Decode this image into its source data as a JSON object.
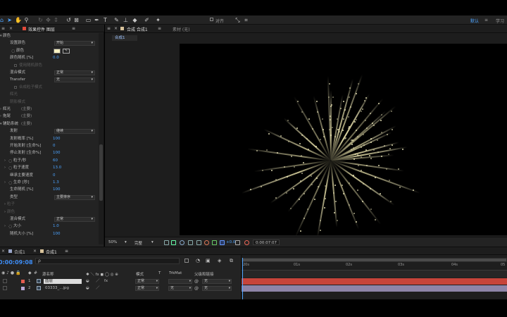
{
  "toolbar": {
    "snap_label": "对齐",
    "workspace_default": "默认",
    "workspace_learn": "学习"
  },
  "effects_panel": {
    "tab_title": "效果控件 图层",
    "rows": [
      {
        "label": "颜色",
        "value": ""
      },
      {
        "label": "设置颜色",
        "value": "开始"
      },
      {
        "label": "颜色",
        "value": ""
      },
      {
        "label": "颜色随机 [%]",
        "value": "0.0"
      },
      {
        "label": "使用随机颜色",
        "value": ""
      },
      {
        "label": "混合模式",
        "value": "正常"
      },
      {
        "label": "Transfer",
        "value": "无"
      },
      {
        "label": "合成粒子模式",
        "value": ""
      },
      {
        "label": "辉光",
        "value": ""
      },
      {
        "label": "阴影模式",
        "value": ""
      },
      {
        "label": "辉光",
        "value": "(主要)"
      },
      {
        "label": "拖尾",
        "value": "(主要)"
      },
      {
        "label": "辅助系统",
        "value": "(主要)"
      },
      {
        "label": "发射",
        "value": "继续"
      },
      {
        "label": "发射概率 [%]",
        "value": "100"
      },
      {
        "label": "开始发射 [生命%]",
        "value": "0"
      },
      {
        "label": "停止发射 [生命%]",
        "value": "100"
      },
      {
        "label": "粒子/秒",
        "value": "60"
      },
      {
        "label": "粒子速度",
        "value": "13.0"
      },
      {
        "label": "继承主要速度",
        "value": "0"
      },
      {
        "label": "生命 [秒]",
        "value": "1.3"
      },
      {
        "label": "生命随机 [%]",
        "value": "100"
      },
      {
        "label": "类型",
        "value": "主要排序"
      },
      {
        "label": "粒子",
        "value": ""
      },
      {
        "label": "颜色",
        "value": ""
      },
      {
        "label": "混合模式",
        "value": "正常"
      },
      {
        "label": "大小",
        "value": "1.0"
      },
      {
        "label": "随机大小 [%]",
        "value": "100"
      }
    ]
  },
  "comp_panel": {
    "tab_title": "合成 合成1",
    "footage_tab": "素材 (无)",
    "sub_tab": "合成1",
    "zoom": "50%",
    "quality": "完整",
    "exposure": "+0.0",
    "timecode": "0:00:07:07"
  },
  "timeline": {
    "tab_render_queue": "合成1",
    "tab_comp": "合成1",
    "current_time": "0:00:09:08",
    "search_placeholder": "ρ",
    "headers": {
      "source_name": "源名称",
      "mode": "模式",
      "trkmat": "TrkMat",
      "parent": "父级和链接"
    },
    "layers": [
      {
        "num": "1",
        "name": "图层",
        "mode": "正常",
        "trkmat": "",
        "parent": "无",
        "color": "#e35b4f"
      },
      {
        "num": "2",
        "name": "03333_...jpg",
        "mode": "正常",
        "trkmat": "无",
        "parent": "无",
        "color": "#b7a6d6"
      }
    ],
    "ruler": [
      "20s",
      "01s",
      "02s",
      "03s",
      "04s",
      "05"
    ]
  },
  "colors": {
    "accent": "#4ba3ff",
    "time_blue": "#3e8ef7",
    "layer1_bar": "#c7443a",
    "layer2_bar": "#8e84a8",
    "firework": "#ece4b0"
  }
}
